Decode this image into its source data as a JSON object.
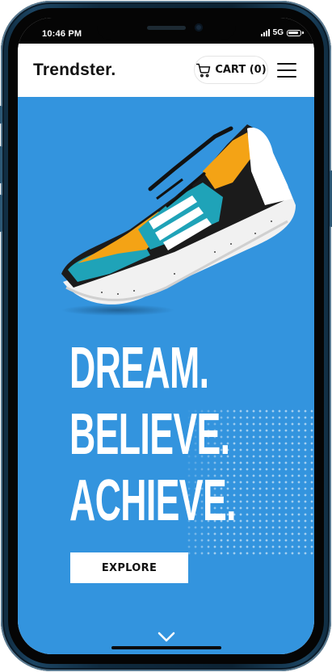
{
  "status_bar": {
    "time": "10:46 PM",
    "network": "5G"
  },
  "header": {
    "logo": "Trendster.",
    "cart_label": "CART (0)"
  },
  "hero": {
    "headline": [
      "DREAM.",
      "BELIEVE.",
      "ACHIEVE."
    ],
    "cta_label": "EXPLORE",
    "product_brand_mark": "adidas"
  },
  "colors": {
    "hero_bg": "#3394de",
    "frame": "#0f2a3e",
    "text_dark": "#111111"
  },
  "icons": [
    "cart-icon",
    "hamburger-menu-icon",
    "chevron-down-icon",
    "signal-icon",
    "battery-icon"
  ]
}
